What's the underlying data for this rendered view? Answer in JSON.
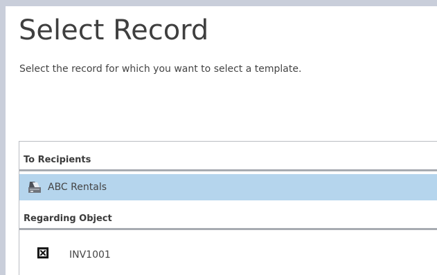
{
  "page": {
    "title": "Select Record",
    "subtitle": "Select the record for which you want to select a template."
  },
  "record_list": {
    "groups": [
      {
        "header": "To Recipients",
        "items": [
          {
            "label": "ABC Rentals",
            "icon": "account-icon",
            "selected": true
          }
        ]
      },
      {
        "header": "Regarding Object",
        "items": [
          {
            "label": "INV1001",
            "icon": "invoice-record-icon",
            "selected": false
          }
        ]
      }
    ]
  },
  "colors": {
    "backdrop": "#c9ceda",
    "dialog_background": "#ffffff",
    "selected_row": "#b5d5ed",
    "header_rule": "#a7abb1",
    "text": "#444444"
  }
}
